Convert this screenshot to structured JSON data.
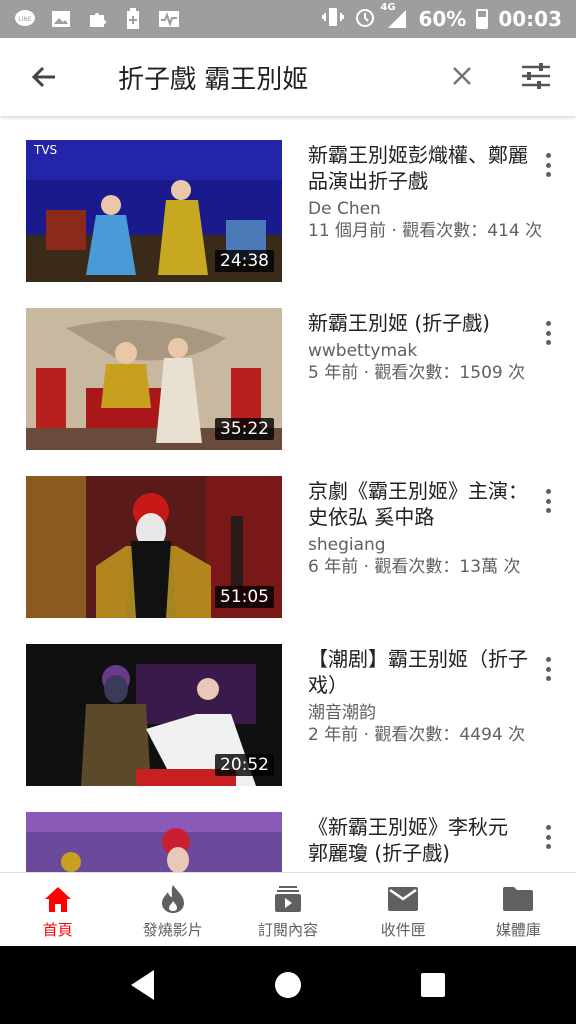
{
  "status_bar": {
    "icons": [
      "line-icon",
      "image-icon",
      "puzzle-icon",
      "battery-saver-icon",
      "pulse-icon"
    ],
    "right_icons": [
      "vibrate-icon",
      "alarm-icon",
      "signal-icon"
    ],
    "network": "4G",
    "battery": "60%",
    "time": "00:03"
  },
  "search": {
    "query": "折子戲 霸王別姬"
  },
  "results": [
    {
      "title": "新霸王別姬彭熾權、鄭麗品演出折子戲",
      "channel": "De Chen",
      "info": "11 個月前 · 觀看次數：414 次",
      "duration": "24:38"
    },
    {
      "title": "新霸王別姬 (折子戲)",
      "channel": "wwbettymak",
      "info": "5 年前 · 觀看次數：1509 次",
      "duration": "35:22"
    },
    {
      "title": "京劇《霸王別姬》主演：史依弘 奚中路",
      "channel": "shegiang",
      "info": "6 年前 · 觀看次數：13萬 次",
      "duration": "51:05"
    },
    {
      "title": "【潮剧】霸王别姬（折子戏）",
      "channel": "潮音潮韵",
      "info": "2 年前 · 觀看次數：4494 次",
      "duration": "20:52"
    },
    {
      "title": "《新霸王別姬》李秋元 郭麗瓊 (折子戲)",
      "channel": "",
      "info": "",
      "duration": ""
    }
  ],
  "bottom_nav": [
    {
      "label": "首頁",
      "icon": "home-icon",
      "active": true
    },
    {
      "label": "發燒影片",
      "icon": "trending-icon",
      "active": false
    },
    {
      "label": "訂閱內容",
      "icon": "subscriptions-icon",
      "active": false
    },
    {
      "label": "收件匣",
      "icon": "inbox-icon",
      "active": false
    },
    {
      "label": "媒體庫",
      "icon": "library-icon",
      "active": false
    }
  ],
  "colors": {
    "accent": "#ff0000",
    "secondary_text": "#606060",
    "status_bar": "#9e9e9e"
  }
}
